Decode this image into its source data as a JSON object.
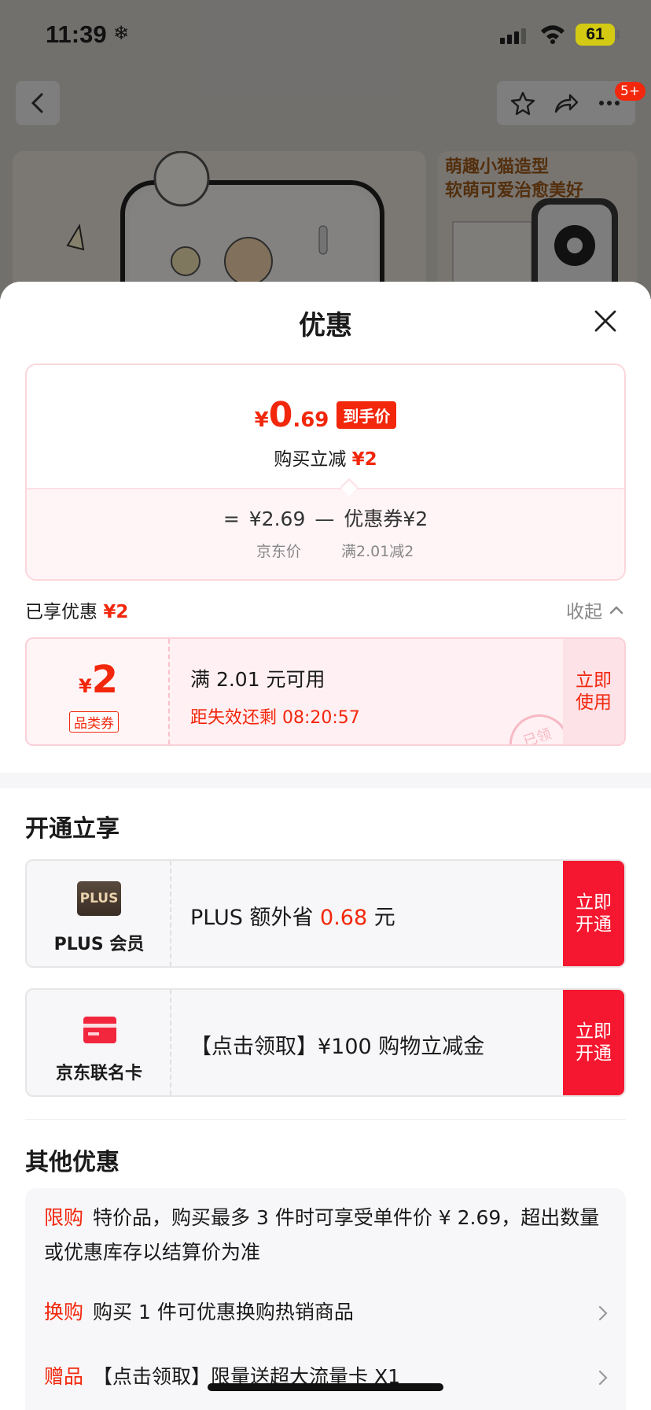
{
  "status_bar": {
    "time": "11:39",
    "snow": "❄",
    "battery": "61"
  },
  "topnav": {
    "badge": "5+"
  },
  "background": {
    "product_caption": "萌趣小猫造型\n软萌可爱治愈美好"
  },
  "sheet": {
    "title": "优惠",
    "price_card": {
      "yen": "¥",
      "final_int": "0",
      "final_dec": ".69",
      "final_tag": "到手价",
      "instant_text": "购买立减",
      "instant_amount": "¥2",
      "formula_eq": "=",
      "formula_base": "¥2.69",
      "formula_minus": "—",
      "formula_coupon": "优惠券¥2",
      "label_base": "京东价",
      "label_coupon": "满2.01减2"
    },
    "enjoyed": {
      "label": "已享优惠",
      "amount": "¥2",
      "collapse_label": "收起"
    },
    "coupon": {
      "yen": "¥",
      "value": "2",
      "kind": "品类券",
      "condition": "满 2.01 元可用",
      "timer": "距失效还剩 08:20:57",
      "action": "立即使用",
      "stamp": "已领"
    },
    "membership": {
      "title": "开通立享",
      "plus": {
        "logo": "PLUS",
        "name": "PLUS 会员",
        "text_prefix": "PLUS 额外省 ",
        "amount": "0.68",
        "text_suffix": " 元",
        "action": "立即开通"
      },
      "card": {
        "name": "京东联名卡",
        "text": "【点击领取】¥100 购物立减金",
        "action": "立即开通"
      }
    },
    "others": {
      "title": "其他优惠",
      "items": [
        {
          "tag": "限购",
          "text": "特价品，购买最多 3 件时可享受单件价 ¥ 2.69，超出数量或优惠库存以结算价为准"
        },
        {
          "tag": "换购",
          "text": "购买 1 件可优惠换购热销商品"
        },
        {
          "tag": "赠品",
          "text": "【点击领取】限量送超大流量卡 X1"
        }
      ]
    }
  },
  "colors": {
    "brand_red": "#f2270c",
    "action_red": "#f5172f",
    "plus_gold": "#e9d2ad"
  }
}
